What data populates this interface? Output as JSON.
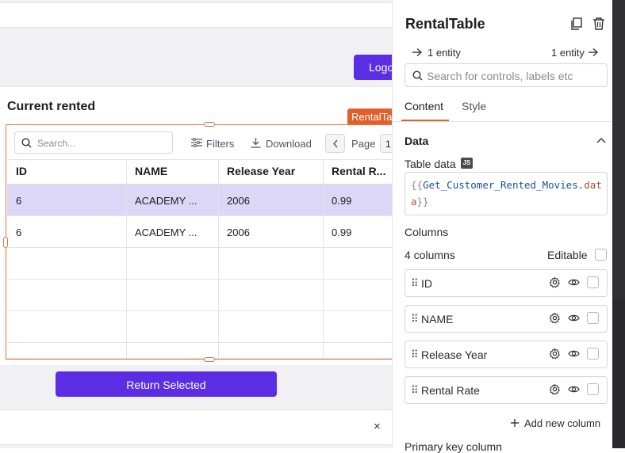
{
  "canvas": {
    "logout_label": "Logo",
    "card_title": "Current rented",
    "widget_tag": "RentalTable",
    "table": {
      "search_placeholder": "Search...",
      "filters_label": "Filters",
      "download_label": "Download",
      "page_label": "Page",
      "page_number": "1",
      "headers": [
        "ID",
        "NAME",
        "Release Year",
        "Rental R..."
      ],
      "rows": [
        {
          "id": "6",
          "name": "ACADEMY ...",
          "year": "2006",
          "rate": "0.99"
        },
        {
          "id": "6",
          "name": "ACADEMY ...",
          "year": "2006",
          "rate": "0.99"
        }
      ]
    },
    "return_label": "Return Selected",
    "close_icon": "×"
  },
  "pane": {
    "title": "RentalTable",
    "entity_in": "1 entity",
    "entity_out": "1 entity",
    "search_placeholder": "Search for controls, labels etc",
    "tabs": [
      {
        "label": "Content"
      },
      {
        "label": "Style"
      }
    ],
    "data_section": "Data",
    "table_data_label": "Table data",
    "js_badge": "JS",
    "table_data_value": {
      "open": "{{",
      "var": "Get_Customer_Rented_Movies",
      "dot": ".",
      "prop": "data",
      "close": "}}"
    },
    "columns_label": "Columns",
    "columns_count": "4 columns",
    "editable_label": "Editable",
    "columns": [
      "ID",
      "NAME",
      "Release Year",
      "Rental Rate"
    ],
    "add_column_label": "Add new column",
    "primary_key_label": "Primary key column"
  },
  "colors": {
    "accent": "#5b2ee6",
    "selection": "#e15f2b",
    "selected_row": "#dcd6f7"
  }
}
